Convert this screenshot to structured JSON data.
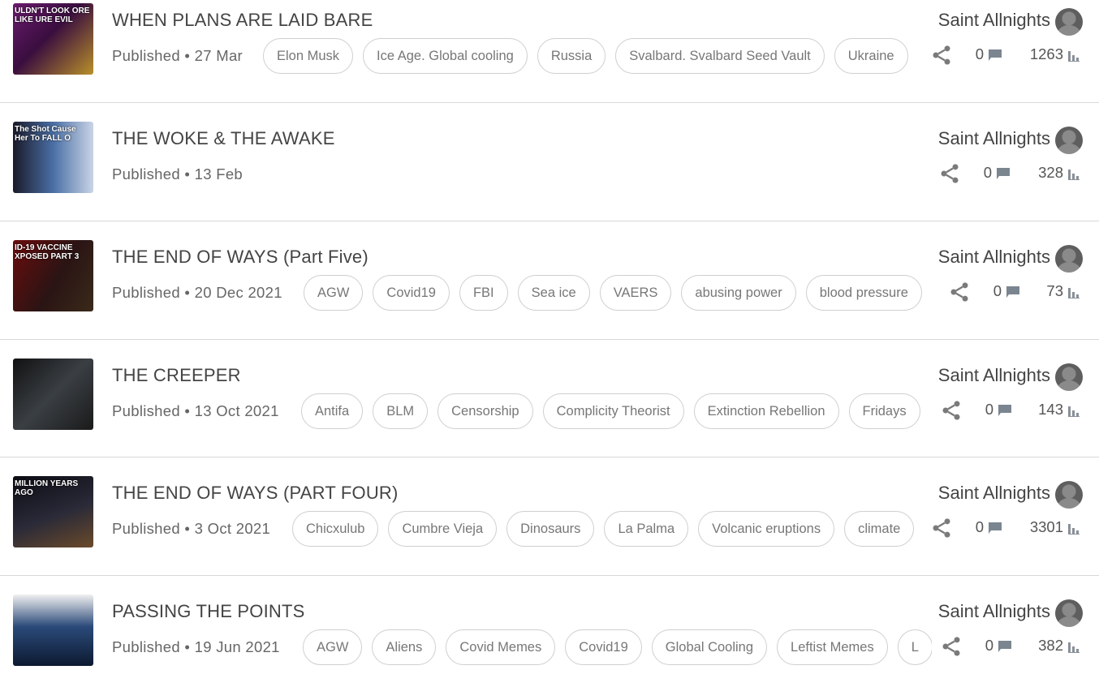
{
  "author_avatar_icon": "user-avatar-icon",
  "stat_icons": {
    "share": "share-icon",
    "comments": "comment-icon",
    "views": "views-bar-chart-icon"
  },
  "colors": {
    "tag_border": "#cfcfcf",
    "separator": "#d8d8d8",
    "text_muted": "#777777"
  },
  "videos": [
    {
      "title": "WHEN PLANS ARE LAID BARE",
      "published": "Published • 27 Mar",
      "author": "Saint Allnights",
      "comments": "0",
      "views": "1263",
      "thumb_text": "ULDN'T LOOK ORE LIKE URE EVIL",
      "tags": [
        "Elon Musk",
        "Ice Age. Global cooling",
        "Russia",
        "Svalbard. Svalbard Seed Vault",
        "Ukraine"
      ]
    },
    {
      "title": "THE WOKE & THE AWAKE",
      "published": "Published • 13 Feb",
      "author": "Saint Allnights",
      "comments": "0",
      "views": "328",
      "thumb_text": "The Shot Cause Her To FALL O",
      "tags": []
    },
    {
      "title": "THE END OF WAYS (Part Five)",
      "published": "Published • 20 Dec 2021",
      "author": "Saint Allnights",
      "comments": "0",
      "views": "73",
      "thumb_text": "ID-19 VACCINE XPOSED PART 3",
      "tags": [
        "AGW",
        "Covid19",
        "FBI",
        "Sea ice",
        "VAERS",
        "abusing power",
        "blood pressure"
      ]
    },
    {
      "title": "THE CREEPER",
      "published": "Published • 13 Oct 2021",
      "author": "Saint Allnights",
      "comments": "0",
      "views": "143",
      "thumb_text": "",
      "tags": [
        "Antifa",
        "BLM",
        "Censorship",
        "Complicity Theorist",
        "Extinction Rebellion",
        "Fridays"
      ]
    },
    {
      "title": "THE END OF WAYS (PART FOUR)",
      "published": "Published • 3 Oct 2021",
      "author": "Saint Allnights",
      "comments": "0",
      "views": "3301",
      "thumb_text": "MILLION YEARS AGO",
      "tags": [
        "Chicxulub",
        "Cumbre Vieja",
        "Dinosaurs",
        "La Palma",
        "Volcanic eruptions",
        "climate"
      ]
    },
    {
      "title": "PASSING THE POINTS",
      "published": "Published • 19 Jun 2021",
      "author": "Saint Allnights",
      "comments": "0",
      "views": "382",
      "thumb_text": "",
      "tags": [
        "AGW",
        "Aliens",
        "Covid Memes",
        "Covid19",
        "Global Cooling",
        "Leftist Memes",
        "L"
      ]
    }
  ]
}
